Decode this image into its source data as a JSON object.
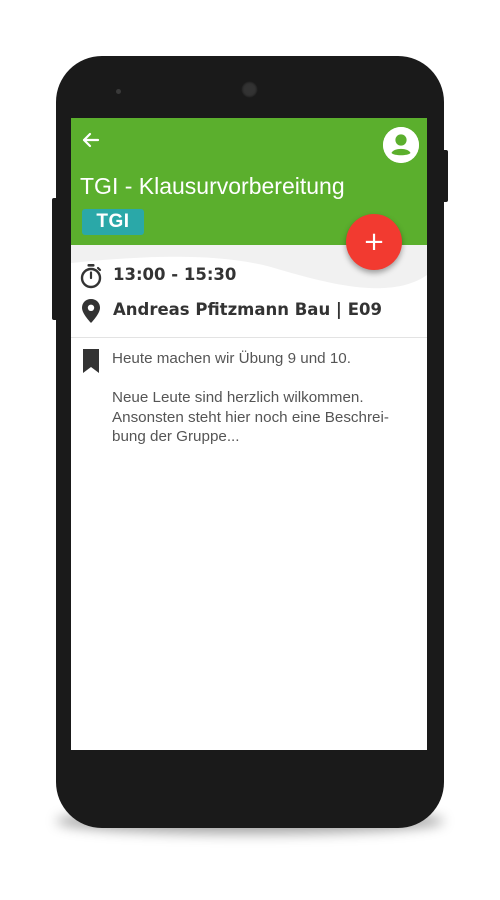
{
  "header": {
    "title": "TGI - Klausurvorbereitung",
    "tag": "TGI",
    "back_icon": "arrow-left-icon",
    "account_icon": "account-circle-icon"
  },
  "fab": {
    "label": "+",
    "icon": "plus-icon"
  },
  "details": {
    "time": "13:00 - 15:30",
    "time_icon": "timer-icon",
    "location": "Andreas Pfitzmann Bau | E09",
    "location_icon": "map-pin-icon"
  },
  "description": {
    "icon": "bookmark-icon",
    "line1": "Heute machen wir Übung 9 und 10.",
    "line2": "Neue Leute sind herzlich wilkommen.",
    "line3": "Ansonsten steht hier noch eine Beschrei-",
    "line4": "bung der Gruppe..."
  },
  "colors": {
    "appbar": "#5baf2d",
    "tag": "#2aa8a8",
    "fab": "#f23a30",
    "phone": "#1a1a1a"
  }
}
